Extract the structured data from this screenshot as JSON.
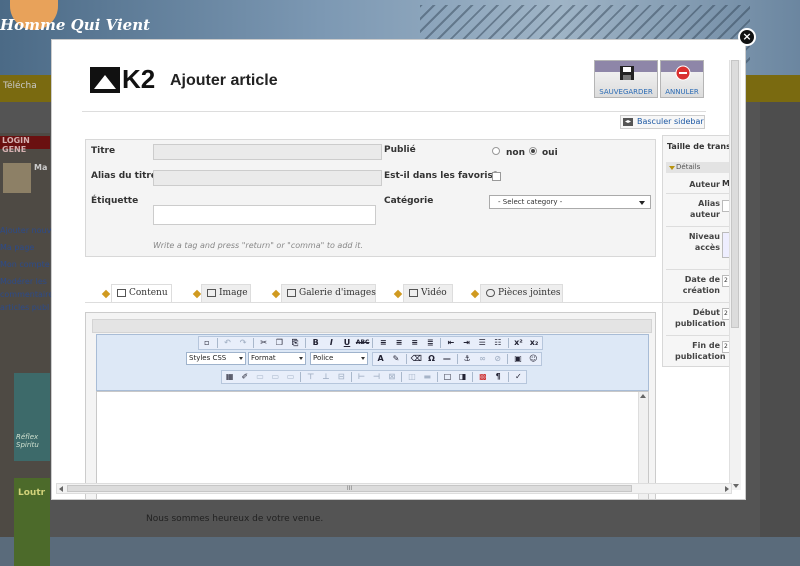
{
  "background": {
    "site_logo": "Homme Qui Vient",
    "nav_first": "Télécha",
    "login_header": "LOGIN GENE",
    "user_short": "Ma",
    "side_links": [
      "Ajouter nouv",
      "Ma page",
      "Mon compte",
      "Modérer les",
      "commentaire",
      "articles publ"
    ],
    "tile1_text": "Réflex Spiritu",
    "tile2_text": "Loutr",
    "footer_text": "Nous sommes heureux de votre venue."
  },
  "modal": {
    "brand": "K2",
    "title": "Ajouter article",
    "toolbar": {
      "save_label": "SAUVEGARDER",
      "cancel_label": "ANNULER"
    },
    "toggle_sidebar": "Basculer sidebar",
    "close_symbol": "×",
    "form": {
      "title_label": "Titre",
      "alias_label": "Alias du titre",
      "tag_label": "Étiquette",
      "tag_hint": "Write a tag and press \"return\" or \"comma\" to add it.",
      "published_label": "Publié",
      "published_no": "non",
      "published_yes": "oui",
      "featured_label": "Est-il dans les favoris?",
      "category_label": "Catégorie",
      "category_value": "- Select category -"
    },
    "sidebar": {
      "title": "Taille de trans",
      "section": "Détails",
      "author_label": "Auteur",
      "author_value": "Ma",
      "alias_author_label": "Alias auteur",
      "access_label": "Niveau accès",
      "created_label": "Date de création",
      "start_label": "Début publication",
      "end_label": "Fin de publication",
      "date_prefix": "2"
    },
    "tabs": [
      "Contenu",
      "Image",
      "Galerie d'images",
      "Vidéo",
      "Pièces jointes"
    ],
    "editor": {
      "styles_label": "Styles CSS",
      "format_label": "Format",
      "font_label": "Police"
    }
  }
}
